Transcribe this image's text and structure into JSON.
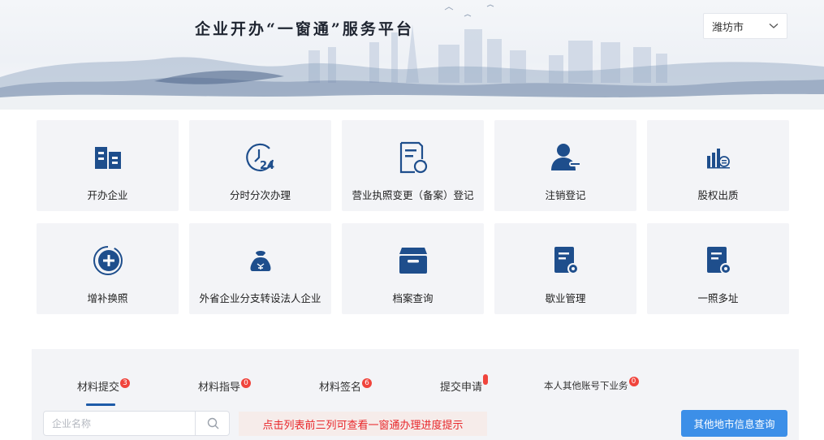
{
  "header": {
    "title": "企业开办“一窗通”服务平台",
    "city": "潍坊市"
  },
  "services": [
    {
      "label": "开办企业",
      "icon": "building-icon"
    },
    {
      "label": "分时分次办理",
      "icon": "clock-24-icon"
    },
    {
      "label": "营业执照变更（备案）登记",
      "icon": "document-refresh-icon"
    },
    {
      "label": "注销登记",
      "icon": "user-remove-icon"
    },
    {
      "label": "股权出质",
      "icon": "stock-chart-icon"
    },
    {
      "label": "增补换照",
      "icon": "plus-circle-icon"
    },
    {
      "label": "外省企业分支转设法人企业",
      "icon": "money-bag-icon"
    },
    {
      "label": "档案查询",
      "icon": "archive-box-icon"
    },
    {
      "label": "歇业管理",
      "icon": "document-gear-icon"
    },
    {
      "label": "一照多址",
      "icon": "document-gear-icon"
    }
  ],
  "tabs": [
    {
      "label": "材料提交",
      "badge": "3"
    },
    {
      "label": "材料指导",
      "badge": "0"
    },
    {
      "label": "材料签名",
      "badge": "6"
    },
    {
      "label": "提交申请",
      "badge": ""
    },
    {
      "label": "本人其他账号下业务",
      "badge": "0"
    }
  ],
  "search": {
    "placeholder": "企业名称",
    "value": ""
  },
  "tip": "点击列表前三列可查看一窗通办理进度提示",
  "other_button": "其他地市信息查询",
  "colors": {
    "icon": "#1e4e8c",
    "accent": "#3c8fe8",
    "badge": "#f0443c",
    "tip_text": "#e8262a"
  }
}
